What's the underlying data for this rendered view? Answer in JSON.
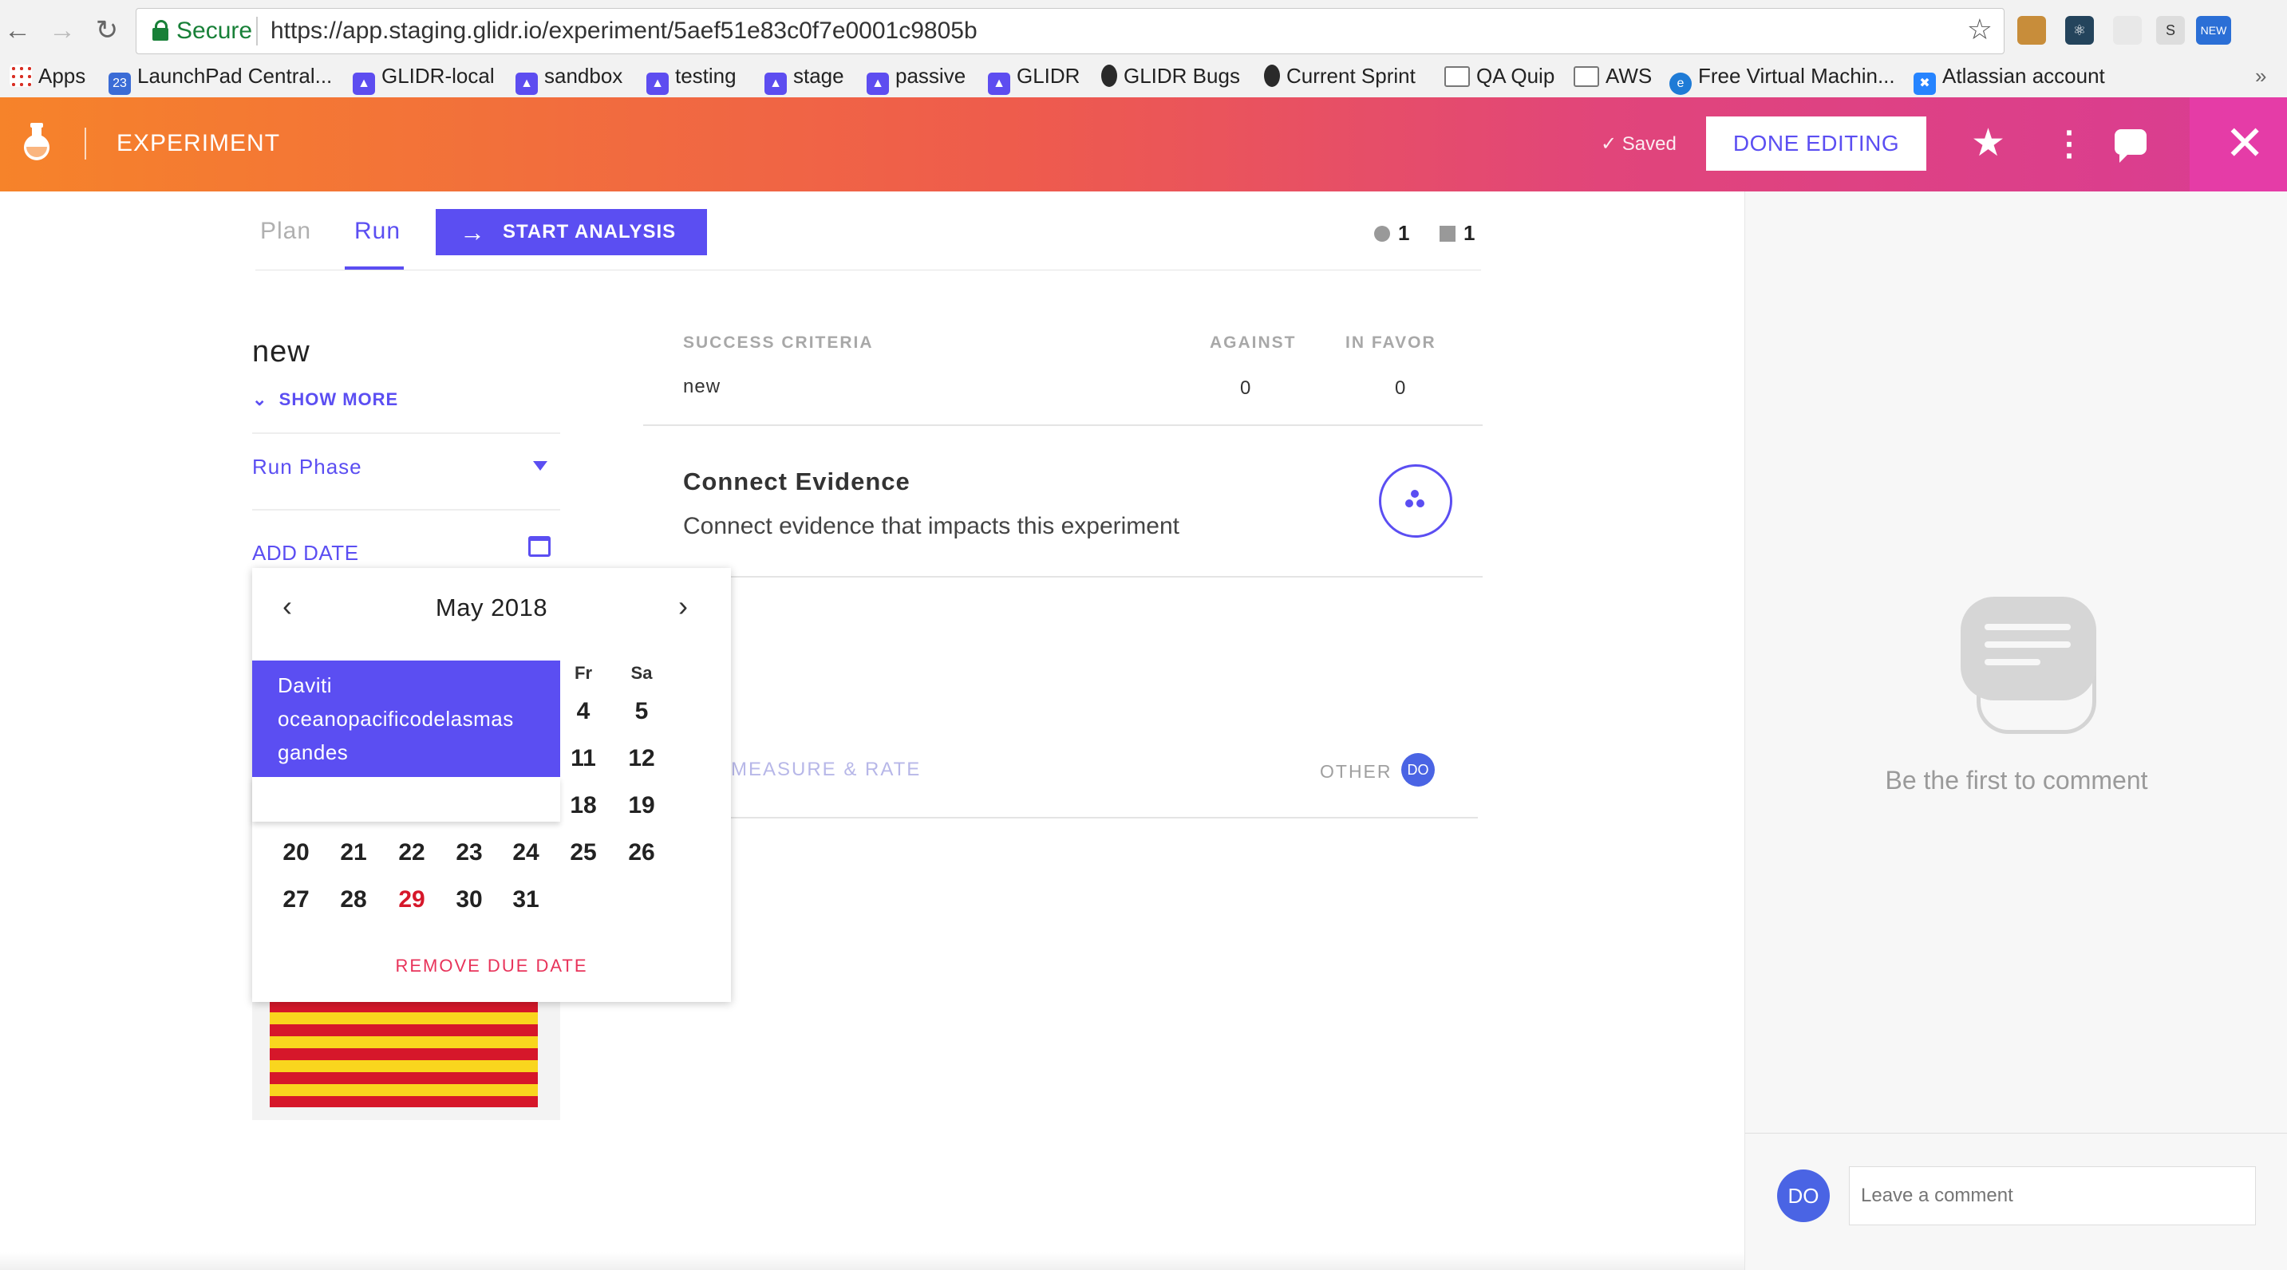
{
  "browser": {
    "secure_label": "Secure",
    "url": "https://app.staging.glidr.io/experiment/5aef51e83c0f7e0001c9805b",
    "new_badge": "NEW",
    "bookmarks": [
      {
        "label": "Apps"
      },
      {
        "label": "LaunchPad Central..."
      },
      {
        "label": "GLIDR-local"
      },
      {
        "label": "sandbox"
      },
      {
        "label": "testing"
      },
      {
        "label": "stage"
      },
      {
        "label": "passive"
      },
      {
        "label": "GLIDR"
      },
      {
        "label": "GLIDR Bugs"
      },
      {
        "label": "Current Sprint"
      },
      {
        "label": "QA Quip"
      },
      {
        "label": "AWS"
      },
      {
        "label": "Free Virtual Machin..."
      },
      {
        "label": "Atlassian account"
      }
    ]
  },
  "header": {
    "title": "EXPERIMENT",
    "saved_label": "Saved",
    "done_button": "DONE EDITING"
  },
  "tabs": {
    "plan": "Plan",
    "run": "Run",
    "start_analysis": "START ANALYSIS",
    "count_a": "1",
    "count_b": "1"
  },
  "left": {
    "experiment_name": "new",
    "show_more": "SHOW MORE",
    "run_phase": "Run Phase",
    "add_date": "ADD DATE"
  },
  "criteria": {
    "head": "SUCCESS CRITERIA",
    "against_head": "AGAINST",
    "favor_head": "IN FAVOR",
    "row_name": "new",
    "row_against": "0",
    "row_favor": "0"
  },
  "evidence": {
    "title": "Connect Evidence",
    "description": "Connect evidence that impacts this experiment"
  },
  "measure": {
    "label": "MEASURE & RATE",
    "other": "OTHER",
    "other_avatar": "DO"
  },
  "datepicker": {
    "month": "May 2018",
    "weekday_headers": [
      "Fr",
      "Sa"
    ],
    "rows": [
      [
        "",
        "",
        "",
        "",
        "",
        "4",
        "5"
      ],
      [
        "",
        "",
        "",
        "",
        "",
        "11",
        "12"
      ],
      [
        "",
        "",
        "",
        "",
        "",
        "18",
        "19"
      ],
      [
        "20",
        "21",
        "22",
        "23",
        "24",
        "25",
        "26"
      ],
      [
        "27",
        "28",
        "29",
        "30",
        "31",
        "",
        ""
      ]
    ],
    "today": "29",
    "remove_label": "REMOVE DUE DATE",
    "tooltip_lines": [
      "Daviti",
      "oceanopacificodelasmas",
      "gandes"
    ]
  },
  "comments": {
    "empty_text": "Be the first to comment",
    "avatar": "DO",
    "placeholder": "Leave a comment"
  },
  "colors": {
    "accent": "#5b4ef2",
    "today": "#d6172a",
    "remove": "#e8335a"
  }
}
